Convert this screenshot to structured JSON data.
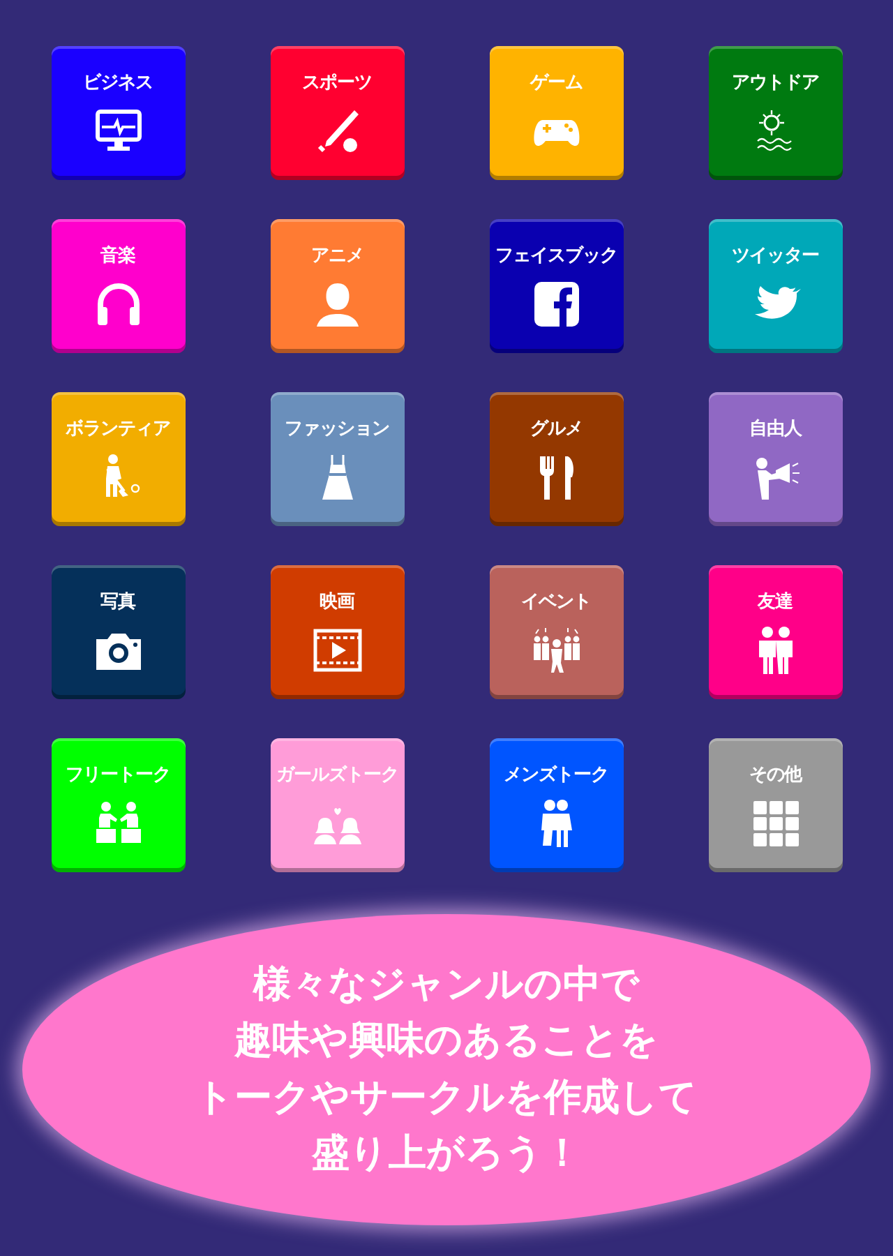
{
  "genres": [
    {
      "label": "ビジネス",
      "kind": "monitor",
      "color": "#1a00ff"
    },
    {
      "label": "スポーツ",
      "kind": "bat",
      "color": "#ff0030"
    },
    {
      "label": "ゲーム",
      "kind": "gamepad",
      "color": "#ffb300"
    },
    {
      "label": "アウトドア",
      "kind": "sun",
      "color": "#007a10"
    },
    {
      "label": "音楽",
      "kind": "headphones",
      "color": "#ff00cc"
    },
    {
      "label": "アニメ",
      "kind": "girl",
      "color": "#ff7b33"
    },
    {
      "label": "フェイスブック",
      "kind": "facebook",
      "color": "#0a00b0"
    },
    {
      "label": "ツイッター",
      "kind": "bird",
      "color": "#00a8b8"
    },
    {
      "label": "ボランティア",
      "kind": "sweeper",
      "color": "#f2ad00"
    },
    {
      "label": "ファッション",
      "kind": "dress",
      "color": "#6a8fbb"
    },
    {
      "label": "グルメ",
      "kind": "cutlery",
      "color": "#943800"
    },
    {
      "label": "自由人",
      "kind": "megaphone",
      "color": "#9068c4"
    },
    {
      "label": "写真",
      "kind": "camera",
      "color": "#05305a"
    },
    {
      "label": "映画",
      "kind": "film",
      "color": "#d03c00"
    },
    {
      "label": "イベント",
      "kind": "crowd",
      "color": "#ba625c"
    },
    {
      "label": "友達",
      "kind": "friends",
      "color": "#ff0088"
    },
    {
      "label": "フリートーク",
      "kind": "talk",
      "color": "#00ff00"
    },
    {
      "label": "ガールズトーク",
      "kind": "girls",
      "color": "#ff9cd8"
    },
    {
      "label": "メンズトーク",
      "kind": "men",
      "color": "#0055ff"
    },
    {
      "label": "その他",
      "kind": "grid",
      "color": "#999999"
    }
  ],
  "message": [
    "様々なジャンルの中で",
    "趣味や興味のあることを",
    "トークやサークルを作成して",
    "盛り上がろう！"
  ]
}
